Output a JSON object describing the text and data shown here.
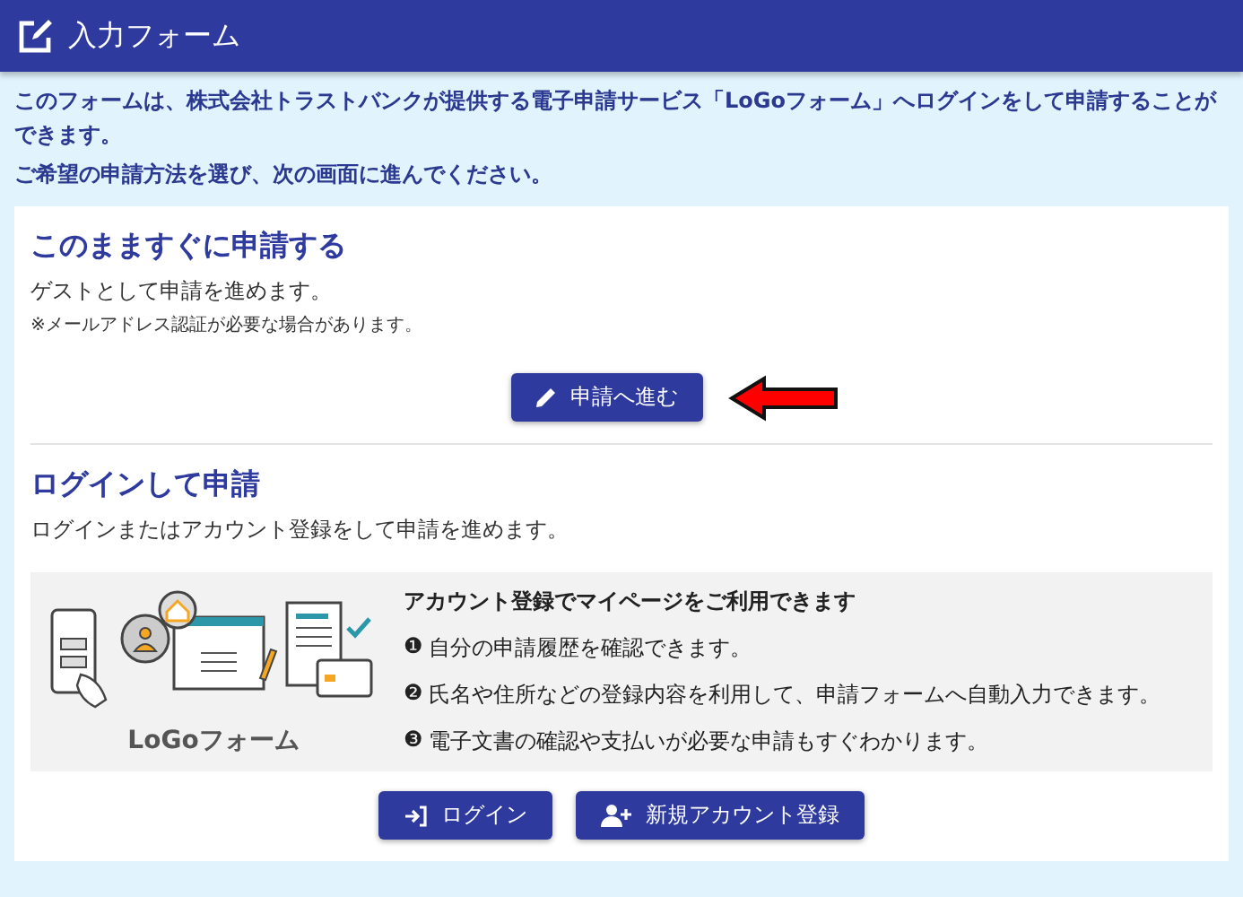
{
  "header": {
    "title": "入力フォーム"
  },
  "intro": [
    "このフォームは、株式会社トラストバンクが提供する電子申請サービス「LoGoフォーム」へログインをして申請することができます。",
    "ご希望の申請方法を選び、次の画面に進んでください。"
  ],
  "guest_section": {
    "title": "このまますぐに申請する",
    "description": "ゲストとして申請を進めます。",
    "note": "※メールアドレス認証が必要な場合があります。",
    "button": "申請へ進む"
  },
  "login_section": {
    "title": "ログインして申請",
    "description": "ログインまたはアカウント登録をして申請を進めます。",
    "info": {
      "logo": "LoGoフォーム",
      "heading": "アカウント登録でマイページをご利用できます",
      "items": [
        {
          "marker": "❶",
          "text": "自分の申請履歴を確認できます。"
        },
        {
          "marker": "❷",
          "text": "氏名や住所などの登録内容を利用して、申請フォームへ自動入力できます。"
        },
        {
          "marker": "❸",
          "text": "電子文書の確認や支払いが必要な申請もすぐわかります。"
        }
      ]
    },
    "buttons": [
      {
        "kind": "login",
        "label": "ログイン"
      },
      {
        "kind": "register",
        "label": "新規アカウント登録"
      }
    ]
  }
}
